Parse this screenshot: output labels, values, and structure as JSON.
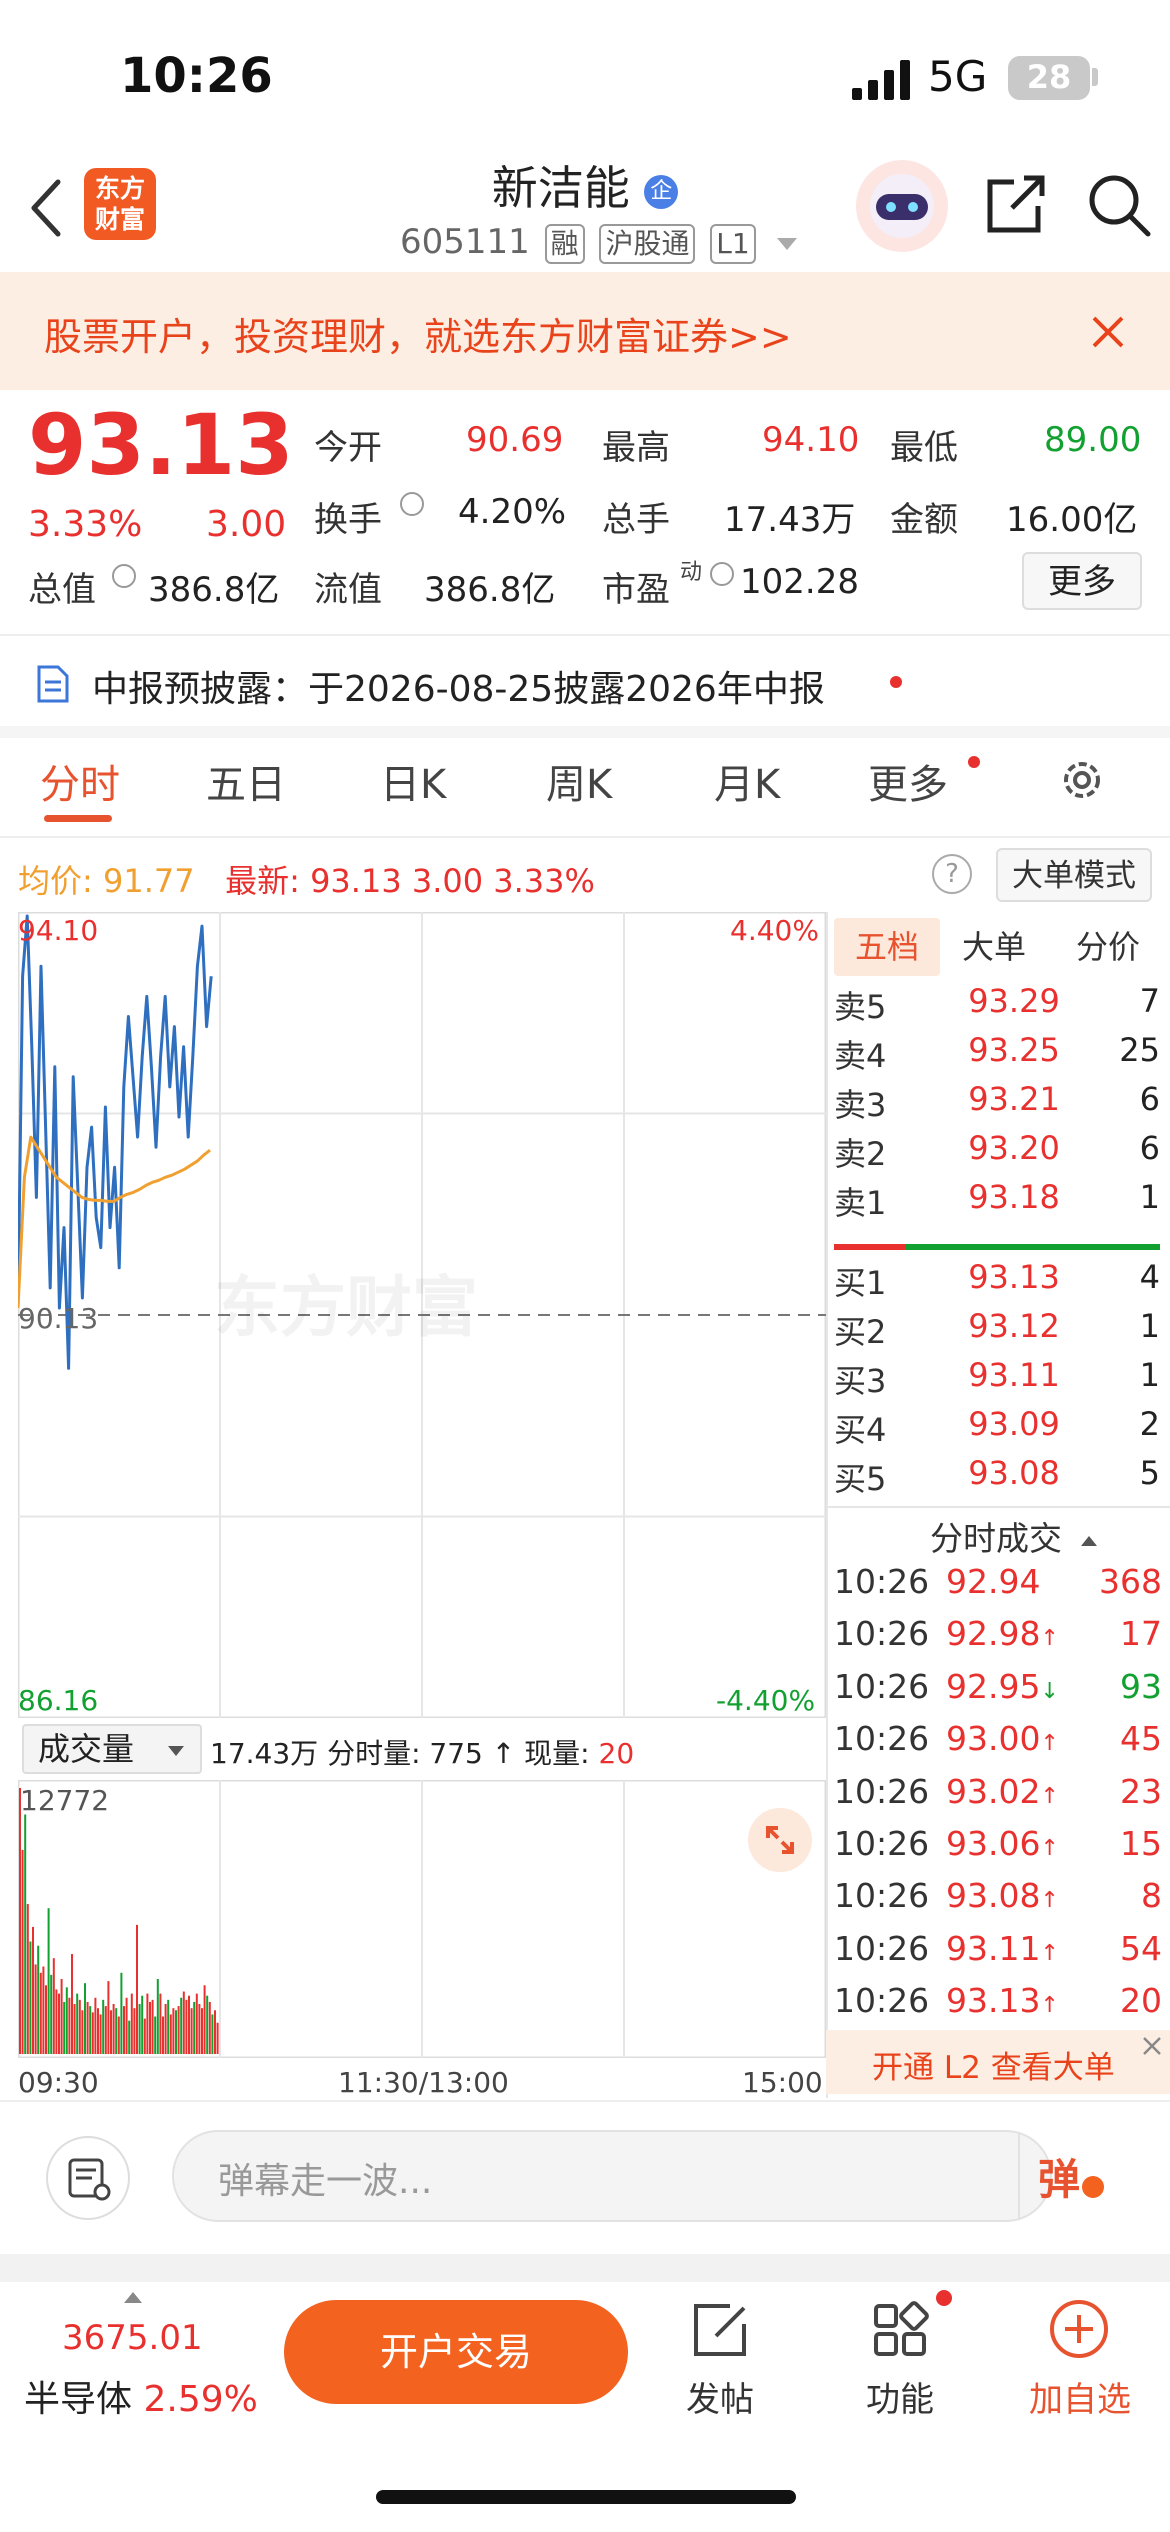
{
  "status_bar": {
    "time": "10:26",
    "network": "5G",
    "battery": "28"
  },
  "header": {
    "logo_text": "东方财富",
    "stock_name": "新洁能",
    "name_badge": "企",
    "stock_code": "605111",
    "tags": [
      "融",
      "沪股通",
      "L1"
    ]
  },
  "banner": {
    "text": "股票开户，投资理财，就选东方财富证券>>"
  },
  "quote": {
    "price": "93.13",
    "change_pct": "3.33%",
    "change": "3.00",
    "rows": [
      [
        {
          "label": "今开",
          "value": "90.69",
          "color": "red"
        },
        {
          "label": "最高",
          "value": "94.10",
          "color": "red"
        },
        {
          "label": "最低",
          "value": "89.00",
          "color": "green"
        }
      ],
      [
        {
          "label": "换手",
          "value": "4.20%",
          "color": "dark"
        },
        {
          "label": "总手",
          "value": "17.43万",
          "color": "dark"
        },
        {
          "label": "金额",
          "value": "16.00亿",
          "color": "dark"
        }
      ],
      [
        {
          "label": "流值",
          "value": "386.8亿",
          "color": "dark"
        },
        {
          "label": "市盈",
          "value": "102.28",
          "color": "dark",
          "super": "动"
        }
      ]
    ],
    "total_value_label": "总值",
    "total_value": "386.8亿",
    "more_button": "更多"
  },
  "notice": {
    "text": "中报预披露：于2026-08-25披露2026年中报"
  },
  "tabs": [
    "分时",
    "五日",
    "日K",
    "周K",
    "月K",
    "更多"
  ],
  "active_tab": 0,
  "info_line": {
    "avg_label": "均价:",
    "avg_value": "91.77",
    "latest_label": "最新:",
    "latest_value": "93.13",
    "latest_change": "3.00",
    "latest_pct": "3.33%",
    "big_order_mode": "大单模式"
  },
  "chart_data": {
    "type": "line",
    "title": "",
    "x_ticks": [
      "09:30",
      "11:30/13:00",
      "15:00"
    ],
    "y_left_ticks": [
      "94.10",
      "90.13",
      "86.16"
    ],
    "y_right_ticks": [
      "4.40%",
      "-4.40%"
    ],
    "ylim": [
      86.16,
      94.1
    ],
    "prev_close": 90.13,
    "series": [
      {
        "color": "#2f6fc0",
        "values": [
          90.2,
          93.5,
          94.1,
          92.8,
          91.3,
          93.6,
          92.0,
          90.4,
          92.6,
          90.2,
          91.0,
          89.6,
          92.5,
          91.4,
          90.3,
          91.6,
          92.0,
          91.1,
          90.8,
          92.2,
          91.0,
          91.6,
          90.6,
          92.4,
          93.1,
          92.5,
          91.9,
          92.7,
          93.3,
          92.6,
          91.8,
          92.7,
          93.3,
          92.4,
          93.0,
          92.1,
          92.8,
          91.9,
          92.7,
          93.6,
          94.0,
          93.0,
          93.5
        ]
      },
      {
        "color": "#f0a030",
        "values": [
          90.2,
          91.5,
          91.9,
          91.8,
          91.7,
          91.6,
          91.5,
          91.45,
          91.4,
          91.35,
          91.3,
          91.28,
          91.27,
          91.27,
          91.26,
          91.26,
          91.3,
          91.33,
          91.35,
          91.38,
          91.42,
          91.45,
          91.47,
          91.5,
          91.52,
          91.55,
          91.58,
          91.62,
          91.66,
          91.72,
          91.77
        ]
      }
    ],
    "volume": {
      "label": "成交量",
      "total": "17.43万",
      "minute_label": "分时量:",
      "minute_value": "775",
      "current_label": "现量:",
      "current_value": "20",
      "max_tick": "12772",
      "bars": [
        12772,
        9800,
        11500,
        7200,
        5400,
        6100,
        4300,
        5200,
        3900,
        4200,
        3300,
        7000,
        3800,
        4600,
        3100,
        2900,
        3600,
        2500,
        3200,
        2700,
        4800,
        2400,
        2900,
        2600,
        2100,
        3400,
        2500,
        2300,
        2000,
        2700,
        2200,
        1900,
        2600,
        2300,
        3500,
        2100,
        2400,
        2200,
        1800,
        3900,
        2300,
        2700,
        1600,
        2900,
        2200,
        6200,
        2400,
        2800,
        1700,
        2900,
        2500,
        2600,
        1800,
        3600,
        2900,
        1800,
        2400,
        2600,
        1900,
        2200,
        2100,
        2300,
        2700,
        3000,
        2600,
        2800,
        2200,
        2500,
        2900,
        2400,
        2200,
        3300,
        2800,
        2500,
        1900,
        2100,
        1500
      ]
    }
  },
  "orderbook": {
    "tabs": [
      "五档",
      "大单",
      "分价"
    ],
    "asks": [
      {
        "label": "卖5",
        "price": "93.29",
        "vol": "7"
      },
      {
        "label": "卖4",
        "price": "93.25",
        "vol": "25"
      },
      {
        "label": "卖3",
        "price": "93.21",
        "vol": "6"
      },
      {
        "label": "卖2",
        "price": "93.20",
        "vol": "6"
      },
      {
        "label": "卖1",
        "price": "93.18",
        "vol": "1"
      }
    ],
    "bids": [
      {
        "label": "买1",
        "price": "93.13",
        "vol": "4"
      },
      {
        "label": "买2",
        "price": "93.12",
        "vol": "1"
      },
      {
        "label": "买3",
        "price": "93.11",
        "vol": "1"
      },
      {
        "label": "买4",
        "price": "93.09",
        "vol": "2"
      },
      {
        "label": "买5",
        "price": "93.08",
        "vol": "5"
      }
    ],
    "ticks_title": "分时成交",
    "ticks": [
      {
        "time": "10:26",
        "price": "92.94",
        "arrow": "",
        "vol": "368",
        "vcolor": "red"
      },
      {
        "time": "10:26",
        "price": "92.98",
        "arrow": "↑",
        "vol": "17",
        "vcolor": "red"
      },
      {
        "time": "10:26",
        "price": "92.95",
        "arrow": "↓",
        "vol": "93",
        "vcolor": "green"
      },
      {
        "time": "10:26",
        "price": "93.00",
        "arrow": "↑",
        "vol": "45",
        "vcolor": "red"
      },
      {
        "time": "10:26",
        "price": "93.02",
        "arrow": "↑",
        "vol": "23",
        "vcolor": "red"
      },
      {
        "time": "10:26",
        "price": "93.06",
        "arrow": "↑",
        "vol": "15",
        "vcolor": "red"
      },
      {
        "time": "10:26",
        "price": "93.08",
        "arrow": "↑",
        "vol": "8",
        "vcolor": "red"
      },
      {
        "time": "10:26",
        "price": "93.11",
        "arrow": "↑",
        "vol": "54",
        "vcolor": "red"
      },
      {
        "time": "10:26",
        "price": "93.13",
        "arrow": "↑",
        "vol": "20",
        "vcolor": "red"
      }
    ],
    "l2_banner": "开通 L2 查看大单"
  },
  "comment": {
    "placeholder": "弹幕走一波...",
    "danmu_button": "弹"
  },
  "bottom_bar": {
    "index_value": "3675.01",
    "sector_name": "半导体",
    "sector_pct": "2.59%",
    "trade_button": "开户交易",
    "nav": [
      "发帖",
      "功能",
      "加自选"
    ]
  },
  "colors": {
    "up": "#e8312f",
    "down": "#12a031",
    "accent": "#f4621f",
    "price_line": "#2f6fc0",
    "avg_line": "#f0a030"
  }
}
